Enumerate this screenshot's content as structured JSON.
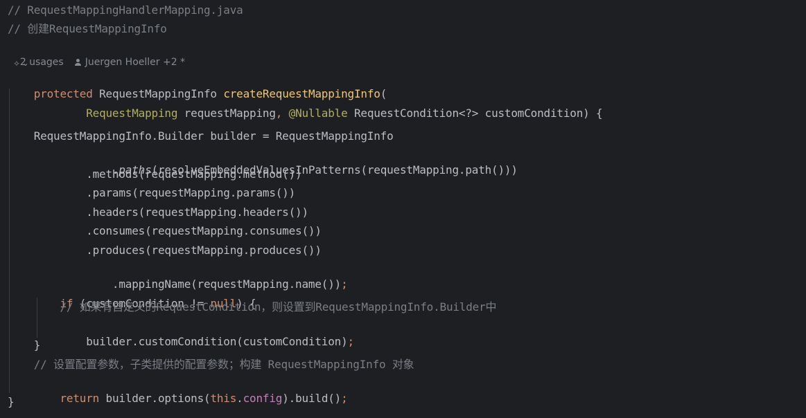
{
  "code": {
    "header_comment_1": "// RequestMappingHandlerMapping.java",
    "header_comment_2": "// 创建RequestMappingInfo",
    "usages": "2 usages",
    "authors": "Juergen Hoeller +2 *",
    "lines": {
      "l1_kw": "protected",
      "l1_type": " RequestMappingInfo ",
      "l1_name": "createRequestMappingInfo",
      "l1_paren": "(",
      "l2_indent": "        ",
      "l2_type": "RequestMapping",
      "l2_rest1": " requestMapping",
      "l2_comma": ",",
      "l2_ann": " @Nullable",
      "l2_rest2": " RequestCondition<?> customCondition) {",
      "l4": "    RequestMappingInfo.Builder builder = RequestMappingInfo",
      "l5_pre": "            .",
      "l5_method": "paths",
      "l5_rest": "(resolveEmbeddedValuesInPatterns(requestMapping.path()))",
      "l6": "            .methods(requestMapping.method())",
      "l7": "            .params(requestMapping.params())",
      "l8": "            .headers(requestMapping.headers())",
      "l9": "            .consumes(requestMapping.consumes())",
      "l10": "            .produces(requestMapping.produces())",
      "l11": "            .mappingName(requestMapping.name())",
      "semicolon": ";",
      "l12_indent": "    ",
      "l12_kw": "if",
      "l12_mid": " (customCondition != ",
      "l12_null": "null",
      "l12_end": ") {",
      "l13": "        // 如果有自定义的RequestCondition，则设置到RequestMappingInfo.Builder中",
      "l14": "        builder.customCondition(customCondition)",
      "l15": "    }",
      "l16": "    // 设置配置参数，子类提供的配置参数；构建 RequestMappingInfo 对象",
      "l17_indent": "    ",
      "l17_kw": "return",
      "l17_mid": " builder.options(",
      "l17_this": "this",
      "l17_dot": ".",
      "l17_field": "config",
      "l17_end": ").build()",
      "l18": "}"
    }
  }
}
